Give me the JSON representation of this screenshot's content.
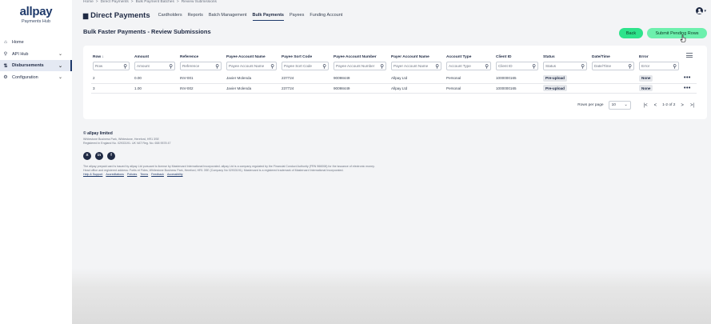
{
  "brand": {
    "name": "allpay",
    "sub": "Payments Hub"
  },
  "sidebar": {
    "items": [
      {
        "label": "Home",
        "icon": "home-icon",
        "glyph": "⌂",
        "chevron": ""
      },
      {
        "label": "API Hub",
        "icon": "api-hub-icon",
        "glyph": "⚲",
        "chevron": "⌄"
      },
      {
        "label": "Disbursements",
        "icon": "disbursements-icon",
        "glyph": "⇅",
        "chevron": "⌄"
      },
      {
        "label": "Configuration",
        "icon": "gear-icon",
        "glyph": "⚙",
        "chevron": "⌄"
      }
    ]
  },
  "breadcrumb": [
    "Home",
    "Direct Payments",
    "Bulk Payment Batches",
    "Review Submissions"
  ],
  "breadcrumb_sep": ">",
  "header": {
    "title": "Direct Payments",
    "tabs": [
      {
        "label": "Cardholders"
      },
      {
        "label": "Reports"
      },
      {
        "label": "Batch Management"
      },
      {
        "label": "Bulk Payments"
      },
      {
        "label": "Payees"
      },
      {
        "label": "Funding Account"
      }
    ],
    "active_tab": "Bulk Payments"
  },
  "page": {
    "title": "Bulk Faster Payments - Review Submissions",
    "back_label": "Back",
    "submit_label": "Submit Pending Rows"
  },
  "table": {
    "columns": [
      {
        "label": "Row",
        "sort": "↓",
        "placeholder": "Row"
      },
      {
        "label": "Amount",
        "sort": "",
        "placeholder": "Amount"
      },
      {
        "label": "Reference",
        "sort": "",
        "placeholder": "Reference"
      },
      {
        "label": "Payee Account Name",
        "sort": "",
        "placeholder": "Payee Account Name"
      },
      {
        "label": "Payee Sort Code",
        "sort": "",
        "placeholder": "Payee Sort Code"
      },
      {
        "label": "Payee Account Number",
        "sort": "",
        "placeholder": "Payee Account Number"
      },
      {
        "label": "Payer Account Name",
        "sort": "",
        "placeholder": "Payer Account Name"
      },
      {
        "label": "Account Type",
        "sort": "",
        "placeholder": "Account Type"
      },
      {
        "label": "Client ID",
        "sort": "",
        "placeholder": "Client ID"
      },
      {
        "label": "Status",
        "sort": "",
        "placeholder": "Status"
      },
      {
        "label": "Date/Time",
        "sort": "",
        "placeholder": "Date/Time"
      },
      {
        "label": "Error",
        "sort": "",
        "placeholder": "Error"
      }
    ],
    "rows": [
      {
        "row": "2",
        "amount": "0.00",
        "reference": "INV-001",
        "payee_name": "Javier Molenda",
        "sort_code": "237724",
        "account_number": "90098449",
        "payer_name": "Allpay Ltd",
        "account_type": "Personal",
        "client_id": "1000000165",
        "status": "Pre-upload",
        "datetime": "",
        "error": "None"
      },
      {
        "row": "3",
        "amount": "1.00",
        "reference": "INV-002",
        "payee_name": "Javier Molenda",
        "sort_code": "237724",
        "account_number": "90098449",
        "payer_name": "Allpay Ltd",
        "account_type": "Personal",
        "client_id": "1000000165",
        "status": "Pre-upload",
        "datetime": "",
        "error": "None"
      }
    ],
    "row_menu": "•••"
  },
  "pagination": {
    "rows_per_page_label": "Rows per page",
    "rows_per_page": "10",
    "range": "1-2 of 2",
    "first": "|<",
    "prev": "<",
    "next": ">",
    "last": ">|"
  },
  "footer": {
    "company": "© allpay limited",
    "address_line1": "Whitestone Business Park, Whitestone, Hereford, HR1 3SE",
    "address_line2": "Registered in England No. 02933191. UK VAT Reg. No. 658 9578 47",
    "social": [
      {
        "icon": "x-icon",
        "glyph": "X"
      },
      {
        "icon": "linkedin-icon",
        "glyph": "in"
      },
      {
        "icon": "facebook-icon",
        "glyph": "f"
      }
    ],
    "legal_line1": "The allpay prepaid card is issued by allpay Ltd pursuant to license by Mastercard International Incorporated. allpay Ltd is a company regulated by the Financial Conduct Authority (FRN 966008) for the issuance of electronic money.",
    "legal_line2": "Head office and registered address: Fortis et Fides, Whitestone Business Park, Hereford, HR1 3SE (Company No 02933191). Mastercard is a registered trademark of Mastercard International Incorporated.",
    "links": [
      "Help & Support",
      "Accreditations",
      "Policies",
      "Terms",
      "Feedback",
      "Accessibility"
    ]
  },
  "colors": {
    "primary": "#1f3a6b",
    "accent_green": "#2ee38b",
    "accent_green_light": "#6df0ad"
  }
}
